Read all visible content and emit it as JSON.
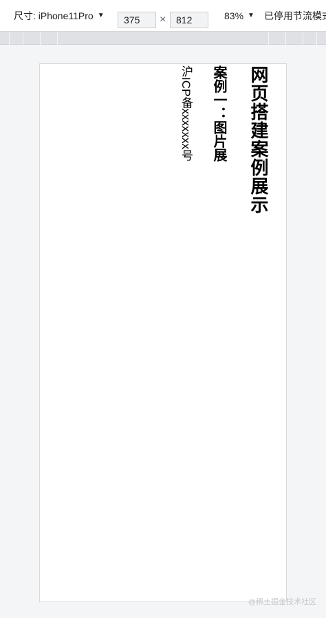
{
  "toolbar": {
    "dimensions_label": "尺寸: iPhone11Pro",
    "dropdown_caret": "▼",
    "width_value": "375",
    "times": "×",
    "height_value": "812",
    "zoom_label": "83%",
    "throttle_label": "已停用节流模式"
  },
  "page": {
    "title": "网页搭建案例展示",
    "case_title": "案例一：图片展",
    "icp": "沪ICP备xxxxxxx号"
  },
  "watermark": "@稀土掘金技术社区"
}
